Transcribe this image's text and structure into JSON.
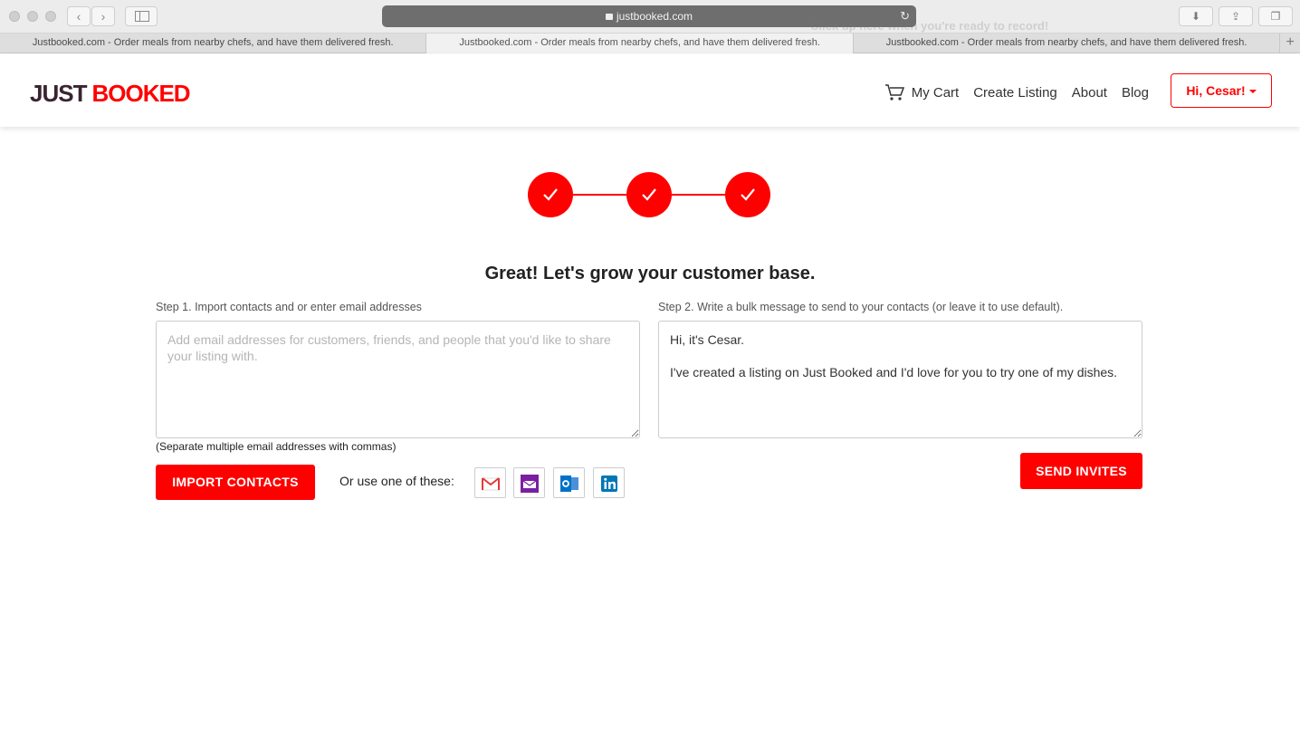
{
  "browser": {
    "url": "justbooked.com",
    "ghost_hint": "Click up here when you're ready to record!",
    "tabs": [
      {
        "label": "Justbooked.com - Order meals from nearby chefs, and have them delivered fresh."
      },
      {
        "label": "Justbooked.com - Order meals from nearby chefs, and have them delivered fresh."
      },
      {
        "label": "Justbooked.com - Order meals from nearby chefs, and have them delivered fresh."
      }
    ],
    "new_tab": "+"
  },
  "header": {
    "logo_just": "JUST",
    "logo_booked": "BOOKED",
    "nav": {
      "cart": "My Cart",
      "create_listing": "Create Listing",
      "about": "About",
      "blog": "Blog"
    },
    "user_menu": "Hi, Cesar!"
  },
  "progress": {
    "completed_steps": 3,
    "total_steps": 3
  },
  "main": {
    "headline": "Great! Let's grow your customer base.",
    "step1": {
      "label": "Step 1. Import contacts and or enter email addresses",
      "placeholder": "Add email addresses for customers, friends, and people that you'd like to share your listing with.",
      "hint": "(Separate multiple email addresses with commas)",
      "import_button": "IMPORT CONTACTS",
      "or_text": "Or use one of these:",
      "providers": [
        "gmail-icon",
        "yahoo-icon",
        "outlook-icon",
        "linkedin-icon"
      ]
    },
    "step2": {
      "label": "Step 2. Write a bulk message to send to your contacts (or leave it to use default).",
      "message": "Hi, it's Cesar.\n\nI've created a listing on Just Booked and I'd love for you to try one of my dishes.",
      "send_button": "SEND INVITES"
    }
  },
  "colors": {
    "brand_red": "#ff0000",
    "logo_dark": "#3a2431"
  }
}
